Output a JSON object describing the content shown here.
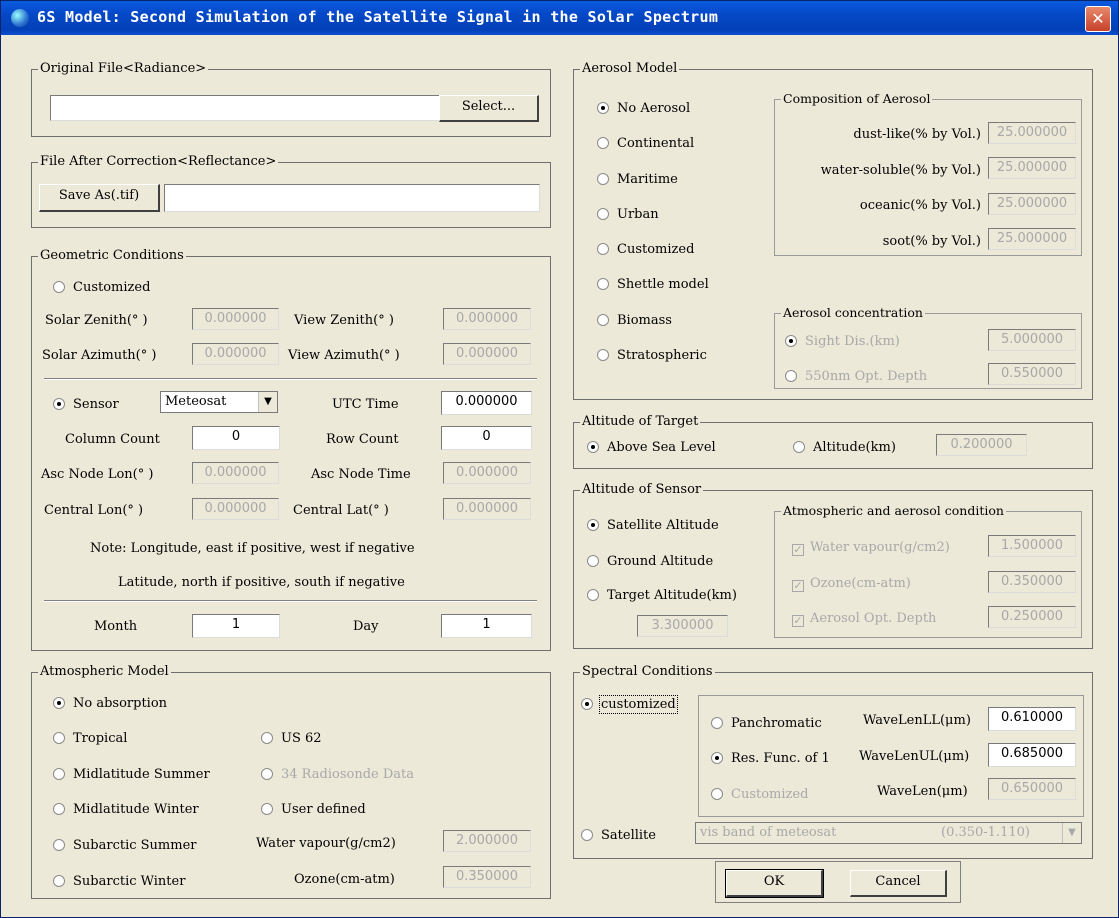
{
  "window": {
    "title": "6S Model: Second Simulation of the Satellite Signal in the Solar Spectrum",
    "close_glyph": "✕"
  },
  "original_file": {
    "legend": "Original File<Radiance>",
    "path_value": "",
    "select_label": "Select..."
  },
  "file_after": {
    "legend": "File After Correction<Reflectance>",
    "save_label": "Save As(.tif)",
    "path_value": ""
  },
  "geometric": {
    "legend": "Geometric Conditions",
    "customized_label": "Customized",
    "solar_zenith_label": "Solar Zenith(° )",
    "solar_zenith": "0.000000",
    "view_zenith_label": "View Zenith(° )",
    "view_zenith": "0.000000",
    "solar_azimuth_label": "Solar Azimuth(° )",
    "solar_azimuth": "0.000000",
    "view_azimuth_label": "View Azimuth(° )",
    "view_azimuth": "0.000000",
    "sensor_label": "Sensor",
    "sensor_value": "Meteosat",
    "utc_label": "UTC Time",
    "utc_value": "0.000000",
    "column_label": "Column Count",
    "column_value": "0",
    "row_label": "Row Count",
    "row_value": "0",
    "asc_lon_label": "Asc Node Lon(° )",
    "asc_lon": "0.000000",
    "asc_time_label": "Asc Node Time",
    "asc_time": "0.000000",
    "central_lon_label": "Central Lon(° )",
    "central_lon": "0.000000",
    "central_lat_label": "Central Lat(° )",
    "central_lat": "0.000000",
    "note1": "Note: Longitude, east if positive, west if negative",
    "note2": "Latitude, north if positive, south if negative",
    "month_label": "Month",
    "month_value": "1",
    "day_label": "Day",
    "day_value": "1"
  },
  "atmospheric": {
    "legend": "Atmospheric Model",
    "no_absorption": "No absorption",
    "tropical": "Tropical",
    "us62": "US 62",
    "mid_summer": "Midlatitude Summer",
    "radiosonde": "34 Radiosonde Data",
    "mid_winter": "Midlatitude Winter",
    "user_defined": "User defined",
    "sub_summer": "Subarctic Summer",
    "water_label": "Water vapour(g/cm2)",
    "water_value": "2.000000",
    "sub_winter": "Subarctic Winter",
    "ozone_label": "Ozone(cm-atm)",
    "ozone_value": "0.350000"
  },
  "aerosol": {
    "legend": "Aerosol Model",
    "options": [
      "No Aerosol",
      "Continental",
      "Maritime",
      "Urban",
      "Customized",
      "Shettle model",
      "Biomass",
      "Stratospheric"
    ],
    "composition_legend": "Composition of Aerosol",
    "dust_label": "dust-like(% by Vol.)",
    "dust_value": "25.000000",
    "water_label": "water-soluble(% by Vol.)",
    "water_value": "25.000000",
    "oceanic_label": "oceanic(% by Vol.)",
    "oceanic_value": "25.000000",
    "soot_label": "soot(% by Vol.)",
    "soot_value": "25.000000",
    "concentration_legend": "Aerosol concentration",
    "sight_label": "Sight Dis.(km)",
    "sight_value": "5.000000",
    "depth_label": "550nm Opt. Depth",
    "depth_value": "0.550000"
  },
  "target_alt": {
    "legend": "Altitude of Target",
    "above_sea": "Above Sea Level",
    "altitude_label": "Altitude(km)",
    "altitude_value": "0.200000"
  },
  "sensor_alt": {
    "legend": "Altitude of Sensor",
    "satellite": "Satellite Altitude",
    "ground": "Ground Altitude",
    "target": "Target Altitude(km)",
    "target_value": "3.300000",
    "cond_legend": "Atmospheric and aerosol condition",
    "water_label": "Water vapour(g/cm2)",
    "water_value": "1.500000",
    "ozone_label": "Ozone(cm-atm)",
    "ozone_value": "0.350000",
    "aod_label": "Aerosol Opt. Depth",
    "aod_value": "0.250000"
  },
  "spectral": {
    "legend": "Spectral Conditions",
    "customized": "customized",
    "panchromatic": "Panchromatic",
    "ll_label": "WaveLenLL(μm)",
    "ll_value": "0.610000",
    "res_func": "Res. Func. of 1",
    "ul_label": "WaveLenUL(μm)",
    "ul_value": "0.685000",
    "cust": "Customized",
    "wl_label": "WaveLen(μm)",
    "wl_value": "0.650000",
    "satellite": "Satellite",
    "band_value": "vis band of meteosat",
    "band_range": "(0.350-1.110)"
  },
  "footer": {
    "ok_label": "OK",
    "cancel_label": "Cancel"
  }
}
